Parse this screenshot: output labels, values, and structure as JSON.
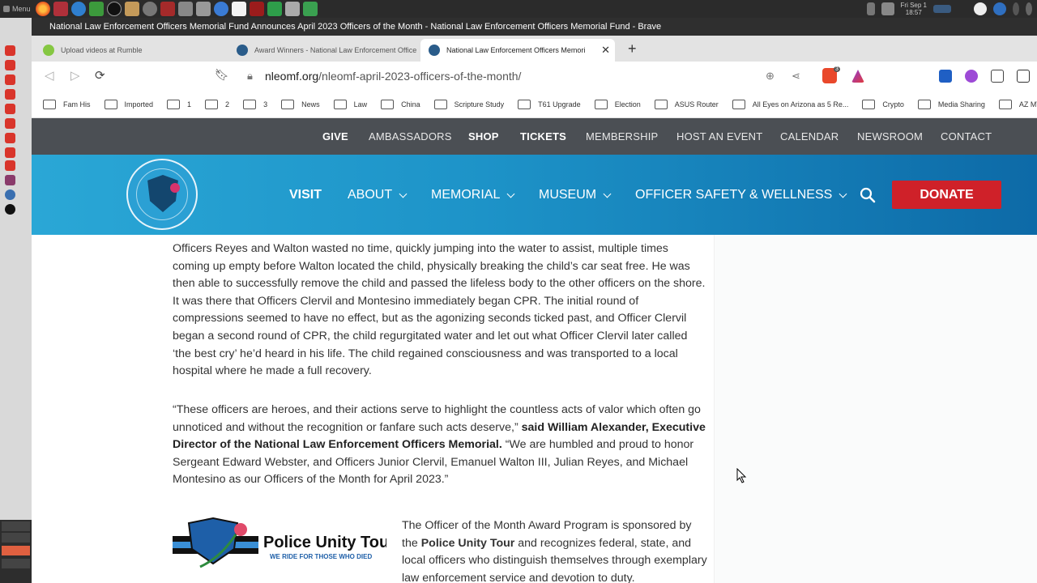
{
  "os": {
    "menu_label": "Menu",
    "clock": {
      "line1": "Fri Sep 1",
      "line2": "18:57"
    }
  },
  "browser": {
    "window_title": "National Law Enforcement Officers Memorial Fund Announces April 2023 Officers of the Month - National Law Enforcement Officers Memorial Fund - Brave",
    "tabs": [
      {
        "label": "Upload videos at Rumble",
        "active": false
      },
      {
        "label": "Award Winners - National Law Enforcement Office",
        "active": false
      },
      {
        "label": "National Law Enforcement Officers Memori",
        "active": true
      }
    ],
    "url": {
      "host": "nleomf.org",
      "path": "/nleomf-april-2023-officers-of-the-month/"
    },
    "shield_badge": "3",
    "bookmarks": [
      "Fam His",
      "Imported",
      "1",
      "2",
      "3",
      "News",
      "Law",
      "China",
      "Scripture Study",
      "T61 Upgrade",
      "Election",
      "ASUS Router",
      "All Eyes on Arizona as 5 Re...",
      "Crypto",
      "Media Sharing",
      "AZ MVD"
    ]
  },
  "site": {
    "util_nav": [
      "GIVE",
      "AMBASSADORS",
      "SHOP",
      "TICKETS",
      "MEMBERSHIP",
      "HOST AN EVENT",
      "CALENDAR",
      "NEWSROOM",
      "CONTACT"
    ],
    "logo_text": "NATIONAL LAW ENFORCEMENT OFFICERS MEMORIAL FUND",
    "main_nav": {
      "visit": "VISIT",
      "about": "ABOUT",
      "memorial": "MEMORIAL",
      "museum": "MUSEUM",
      "officer_safety": "OFFICER SAFETY & WELLNESS"
    },
    "donate_label": "DONATE",
    "colors": {
      "accent_red": "#cf2129",
      "nav_blue": "#1d93c8",
      "util_gray": "#4b4f54"
    }
  },
  "article": {
    "para1": "Officers Reyes and Walton wasted no time, quickly jumping into the water to assist, multiple times coming up empty before Walton located the child, physically breaking the child’s car seat free. He was then able to successfully remove the child and passed the lifeless body to the other officers on the shore. It was there that Officers Clervil and Montesino immediately began CPR. The initial round of compressions seemed to have no effect, but as the agonizing seconds ticked past, and Officer Clervil began a second round of CPR, the child regurgitated water and let out what Officer Clervil later called ‘the best cry’ he’d heard in his life. The child regained consciousness and was transported to a local hospital where he made a full recovery.",
    "para2_a": "“These officers are heroes, and their actions serve to highlight the countless acts of valor which often go unnoticed and without the recognition or fanfare such acts deserve,”",
    "para2_bold": "said William Alexander, Executive Director of the National Law Enforcement Officers Memorial.",
    "para2_b": "“We are humbled and proud to honor Sergeant Edward Webster, and Officers Junior Clervil, Emanuel Walton III, Julian Reyes, and Michael Montesino as our Officers of the Month for April 2023.”",
    "put_title": "Police Unity Tour",
    "put_tagline": "WE RIDE FOR THOSE WHO DIED",
    "sponsor_a": "The Officer of the Month Award Program is sponsored by the",
    "sponsor_bold": "Police Unity Tour",
    "sponsor_b": "and recognizes federal, state, and local officers who distinguish themselves through exemplary law enforcement service and devotion to duty."
  }
}
